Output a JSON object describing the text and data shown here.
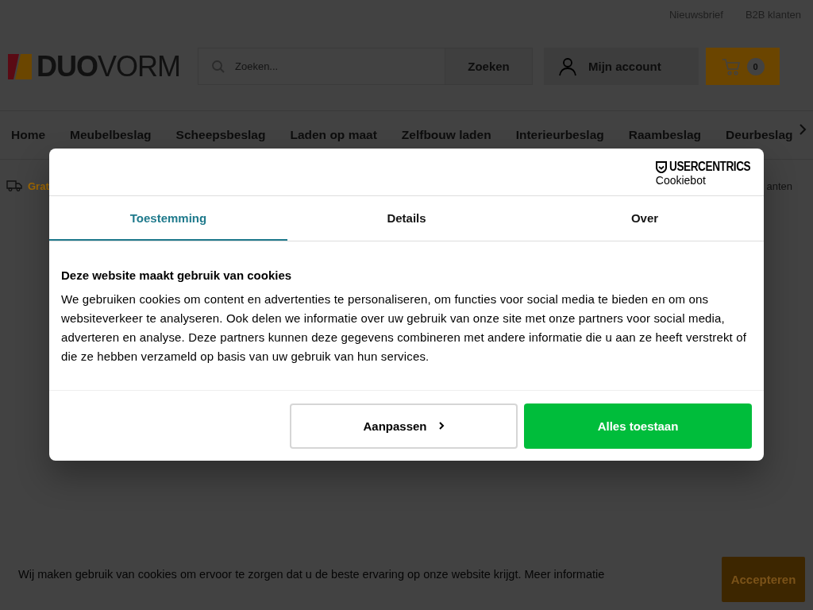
{
  "top_links": [
    "Nieuwsbrief",
    "B2B klanten"
  ],
  "logo": {
    "bold": "DUO",
    "light": "VORM"
  },
  "search": {
    "placeholder": "Zoeken...",
    "button": "Zoeken"
  },
  "account": {
    "label": "Mijn account"
  },
  "cart": {
    "count": "0"
  },
  "nav": [
    "Home",
    "Meubelbeslag",
    "Scheepsbeslag",
    "Laden op maat",
    "Zelfbouw laden",
    "Interieurbeslag",
    "Raambeslag",
    "Deurbeslag"
  ],
  "usp_row": {
    "left": "Grat",
    "right": "anten"
  },
  "cookie_dialog": {
    "brand": "USERCENTRICS",
    "product": "Cookiebot",
    "tabs": [
      {
        "label": "Toestemming",
        "selected": true
      },
      {
        "label": "Details",
        "selected": false
      },
      {
        "label": "Over",
        "selected": false
      }
    ],
    "heading": "Deze website maakt gebruik van cookies",
    "body": "We gebruiken cookies om content en advertenties te personaliseren, om functies voor social media te bieden en om ons websiteverkeer te analyseren. Ook delen we informatie over uw gebruik van onze site met onze partners voor social media, adverteren en analyse. Deze partners kunnen deze gegevens combineren met andere informatie die u aan ze heeft verstrekt of die ze hebben verzameld op basis van uw gebruik van hun services.",
    "customize_button": "Aanpassen",
    "accept_button": "Alles toestaan"
  },
  "cookie_bar": {
    "text": "Wij maken gebruik van cookies om ervoor te zorgen dat u de beste ervaring op onze website krijgt.",
    "link": "Meer informatie",
    "button": "Accepteren"
  }
}
